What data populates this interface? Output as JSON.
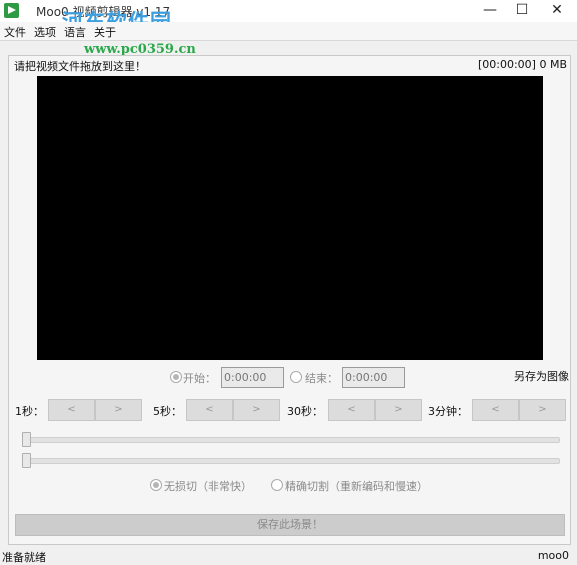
{
  "window": {
    "title": "Moo0 视频剪辑器 v1.17",
    "watermark": "河东软件园",
    "watermark_url": "www.pc0359.cn",
    "controls": {
      "minimize": "—",
      "maximize": "☐",
      "close": "✕"
    }
  },
  "menu": {
    "items": [
      "文件",
      "选项",
      "语言",
      "关于"
    ]
  },
  "header": {
    "drop_hint": "请把视频文件拖放到这里！",
    "time_size": "[00:00:00]   0 MB"
  },
  "range": {
    "start_label": "开始：",
    "start_value": "0:00:00",
    "end_label": "结束：",
    "end_value": "0:00:00",
    "save_image": "另存为图像"
  },
  "steps": [
    {
      "label": "1秒：",
      "prev": "<",
      "next": ">"
    },
    {
      "label": "5秒：",
      "prev": "<",
      "next": ">"
    },
    {
      "label": "30秒：",
      "prev": "<",
      "next": ">"
    },
    {
      "label": "3分钟：",
      "prev": "<",
      "next": ">"
    }
  ],
  "cut_modes": {
    "lossless": "无损切（非常快）",
    "precise": "精确切割（重新编码和慢速）",
    "selected": "lossless"
  },
  "save_scene": "保存此场景！",
  "status": {
    "left": "准备就绪",
    "right": "moo0"
  },
  "colors": {
    "watermark": "#3c9fe0",
    "watermark_url": "#2aa84a",
    "video_bg": "#000000"
  }
}
